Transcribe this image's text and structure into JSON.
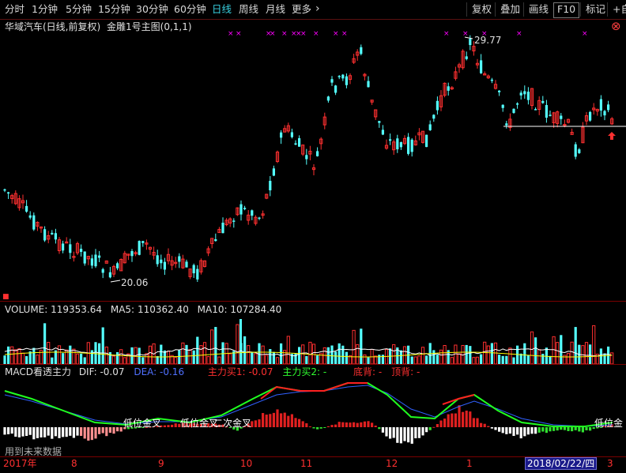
{
  "tabs": [
    {
      "label": "分时",
      "active": false
    },
    {
      "label": "1分钟",
      "active": false
    },
    {
      "label": "5分钟",
      "active": false
    },
    {
      "label": "15分钟",
      "active": false
    },
    {
      "label": "30分钟",
      "active": false
    },
    {
      "label": "60分钟",
      "active": false
    },
    {
      "label": "日线",
      "active": true
    },
    {
      "label": "周线",
      "active": false
    },
    {
      "label": "月线",
      "active": false
    },
    {
      "label": "更多",
      "active": false
    }
  ],
  "more_chevron": "›",
  "right_buttons": [
    "复权",
    "叠加",
    "画线",
    "F10",
    "标记"
  ],
  "self_select": "+自",
  "close_symbol": "⊗",
  "chart_title": "华域汽车(日线,前复权)",
  "indicator_title": "金雕1号主图(0,1,1)",
  "price_high_label": "29.77",
  "price_low_label": "20.06",
  "volume_panel": {
    "label": "VOLUME:",
    "volume": "119353.64",
    "ma5_label": "MA5:",
    "ma5": "110362.40",
    "ma10_label": "MA10:",
    "ma10": "107284.40"
  },
  "macd_panel": {
    "name": "MACD看透主力",
    "dif_label": "DIF:",
    "dif": "-0.07",
    "dea_label": "DEA:",
    "dea": "-0.16",
    "buy1_label": "主力买1:",
    "buy1": "-0.07",
    "buy2_label": "主力买2:",
    "buy2": "-",
    "bottom_div_label": "底背:",
    "bottom_div": "-",
    "top_div_label": "顶背:",
    "top_div": "-"
  },
  "macd_annotations": [
    "低位金叉",
    "低位金叉",
    "二次金叉",
    "低位金"
  ],
  "future_data_note": "用到未来数据",
  "x_axis": {
    "year_label": "2017年",
    "months": [
      "8",
      "9",
      "10",
      "11",
      "12",
      "1",
      "3"
    ],
    "selected_date": "2018/02/22/四"
  },
  "colors": {
    "up": "#ff3030",
    "down": "#54ffff",
    "accent_tab": "#39d0e0",
    "divider": "#7a0000",
    "ma_white": "#ffffff",
    "ma_yellow": "#ffff00",
    "dif_red": "#ff2020",
    "dea_green": "#20ff20",
    "dea_blue": "#3060ff",
    "marker_magenta": "#ff00ff"
  },
  "icons": [
    "close-circle-icon",
    "arrow-up-icon"
  ],
  "chart_data": {
    "type": "candlestick",
    "title": "",
    "price_range": [
      19.5,
      31.5
    ],
    "series_note": "",
    "high": 29.77,
    "low": 20.06
  }
}
